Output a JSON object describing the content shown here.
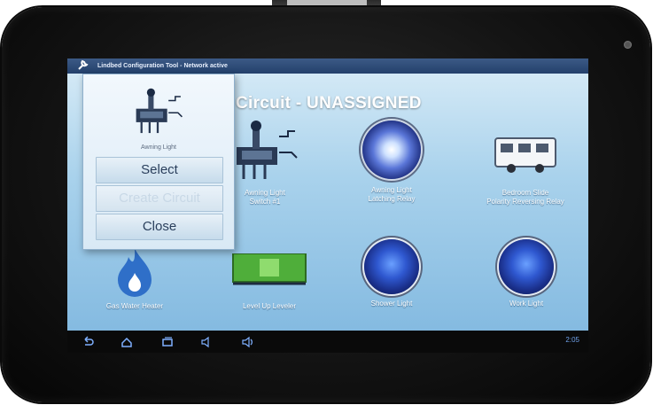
{
  "status_bar": {
    "title": "Lindbed Configuration Tool - Network active"
  },
  "header": {
    "title": "Circuit - UNASSIGNED"
  },
  "popup": {
    "caption": "Awning Light",
    "buttons": {
      "select": "Select",
      "create_circuit": "Create Circuit",
      "close": "Close"
    }
  },
  "tiles": [
    {
      "line1": "Awning Light",
      "line2": "Switch #1",
      "icon": "switch-icon"
    },
    {
      "line1": "Awning Light",
      "line2": "Latching Relay",
      "icon": "light-bulb-icon"
    },
    {
      "line1": "Bedroom Slide",
      "line2": "Polarity Reversing Relay",
      "icon": "rv-slide-icon"
    },
    {
      "line1": "Gas Water Heater",
      "line2": "",
      "icon": "flame-icon"
    },
    {
      "line1": "Level Up Leveler",
      "line2": "",
      "icon": "level-icon"
    },
    {
      "line1": "Shower Light",
      "line2": "",
      "icon": "light-bulb-icon"
    },
    {
      "line1": "Work Light",
      "line2": "",
      "icon": "light-bulb-icon"
    }
  ],
  "nav_bar": {
    "buttons": [
      "back-icon",
      "home-icon",
      "recent-apps-icon",
      "volume-down-icon",
      "volume-up-icon"
    ],
    "clock": "2:05"
  },
  "colors": {
    "accent": "#23406b",
    "screen_bg": "#a9d2ec",
    "nav_bar": "#0a0a0a"
  }
}
